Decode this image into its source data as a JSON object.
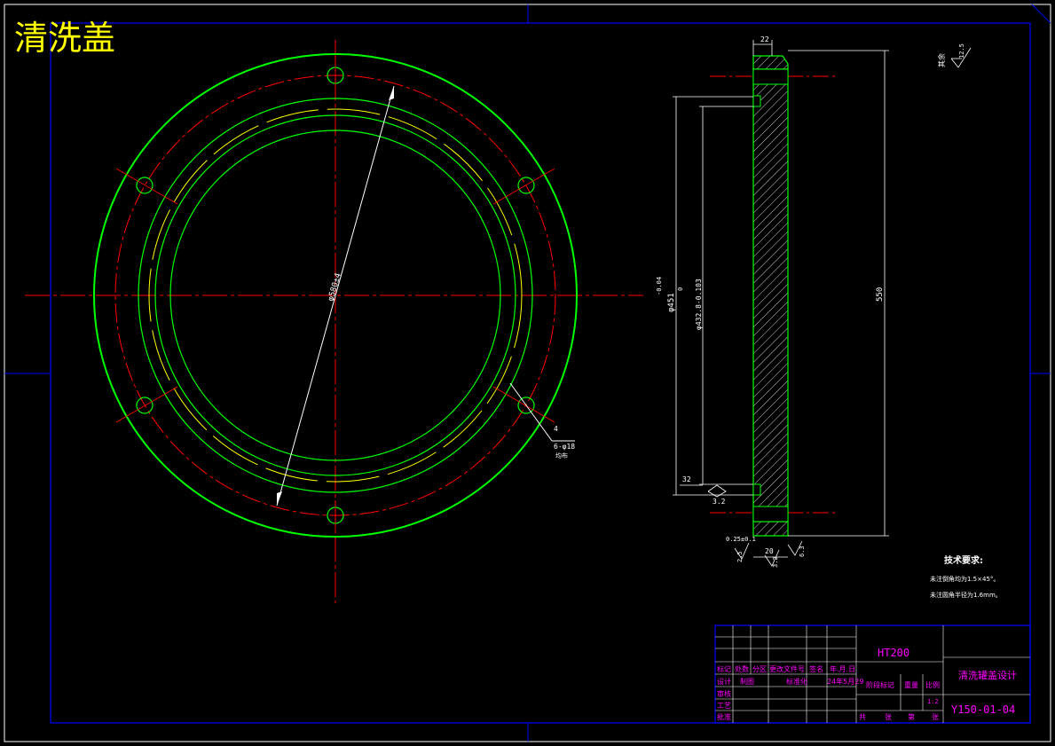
{
  "drawing_title": "清洗盖",
  "colors": {
    "background": "#000000",
    "frame": "#0000ff",
    "outline_green": "#00ff00",
    "center_red": "#ff0000",
    "dim_white": "#ffffff",
    "yellow": "#ffff00",
    "magenta": "#ff00ff",
    "hatch_green": "#00ff00"
  },
  "front_view": {
    "diameter_label": "φ580±4",
    "hole_label_1": "4",
    "hole_label_2": "6-φ18",
    "hole_label_3": "均布"
  },
  "side_view": {
    "top_dim": "22",
    "left_dim_1": "φ451",
    "left_dim_1_tol": "-0.04",
    "left_dim_1_tol_b": "0",
    "left_dim_2": "φ432.8-0.103",
    "right_dim": "550",
    "bottom_dim_1": "0.25±0.1",
    "bottom_dim_2": "20",
    "bottom_left_rough": "32",
    "bottom_left_rough_2": "3.2",
    "rough_small_1": "2.5",
    "rough_small_2": "3.2",
    "rough_small_3": "6.3"
  },
  "roughness_note": {
    "label": "其余",
    "value": "12.5"
  },
  "tech_requirements": {
    "title": "技术要求:",
    "line1": "未注倒角均为1.5×45°。",
    "line2": "未注圆角半径为1.6mm。"
  },
  "title_block": {
    "material": "HT200",
    "part_name": "清洗罐盖设计",
    "drawing_no": "Y150-01-04",
    "scale": "1:2",
    "row_headers": [
      "标记",
      "处数",
      "分区",
      "更改文件号",
      "签名",
      "年.月.日"
    ],
    "design_label": "设计",
    "standardize_label": "标准化",
    "date_value": "24年5月29",
    "stage_label": "阶段标记",
    "weight_label": "重量",
    "ratio_label": "比例",
    "check_label": "审核",
    "process_label": "工艺",
    "approve_label": "批准",
    "draw_label": "制图",
    "total_label": "共",
    "sheet_label": "张",
    "page_label": "第",
    "page_label2": "张"
  }
}
